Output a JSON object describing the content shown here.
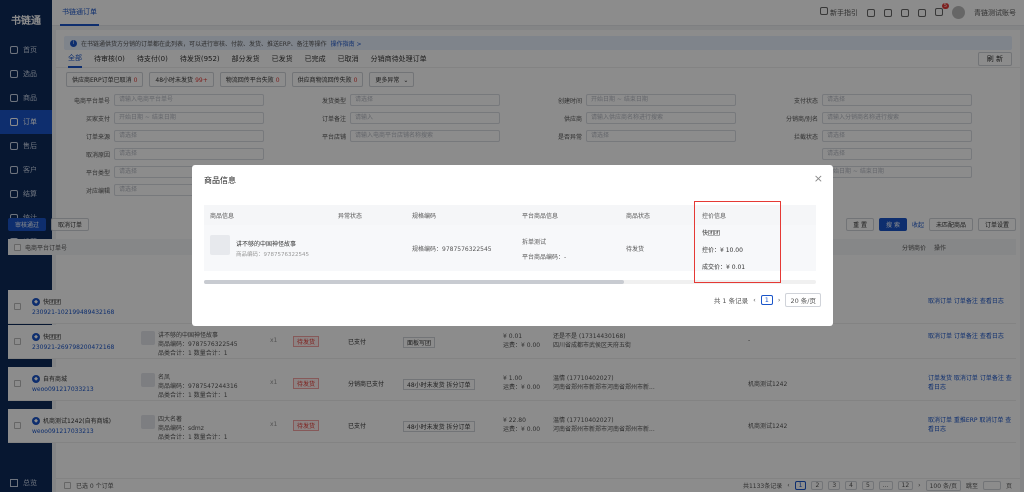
{
  "sidebar": {
    "logo": "书链通",
    "items": [
      {
        "label": "首页",
        "icon": "home-icon"
      },
      {
        "label": "选品",
        "icon": "select-icon"
      },
      {
        "label": "商品",
        "icon": "goods-icon"
      },
      {
        "label": "订单",
        "icon": "order-icon",
        "active": true
      },
      {
        "label": "售后",
        "icon": "aftersale-icon"
      },
      {
        "label": "客户",
        "icon": "customer-icon"
      },
      {
        "label": "结算",
        "icon": "settle-icon"
      },
      {
        "label": "统计",
        "icon": "stats-icon"
      },
      {
        "label": "设置",
        "icon": "settings-icon"
      }
    ],
    "footer": "总览"
  },
  "topbar": {
    "tab": "书链通订单",
    "guide": "新手指引",
    "notify_count": "5",
    "account": "青链测试账号"
  },
  "notice": {
    "text": "在书链通供货方分销的订单都在此列表，可以进行审核、付款、发货、推送ERP、备注等操作",
    "link": "操作指南 >"
  },
  "status_tabs": [
    "全部",
    "待审核(0)",
    "待支付(0)",
    "待发货(952)",
    "部分发货",
    "已发货",
    "已完成",
    "已取消",
    "分销商待处理订单"
  ],
  "refresh_label": "刷 新",
  "chips": [
    {
      "label": "供应商ERP订单已取消",
      "num": "0"
    },
    {
      "label": "48小时未发货",
      "num": "99+"
    },
    {
      "label": "物流回传平台失败",
      "num": "0"
    },
    {
      "label": "供应商物流回传失败",
      "num": "0"
    },
    {
      "label": "更多异常",
      "num": ""
    }
  ],
  "filters": [
    [
      {
        "label": "电商平台单号",
        "ph": "请输入电商平台单号"
      },
      {
        "label": "发货类型",
        "ph": "请选择"
      },
      {
        "label": "创建时间",
        "ph": "开始日期 ~ 结束日期"
      },
      {
        "label": "支付状态",
        "ph": "请选择"
      }
    ],
    [
      {
        "label": "买家支付",
        "ph": "开始日期 ~ 结束日期"
      },
      {
        "label": "订单备注",
        "ph": "请输入"
      },
      {
        "label": "供应商",
        "ph": "请输入供应商名称进行搜索"
      },
      {
        "label": "分销商/别名",
        "ph": "请输入分销商名称进行搜索"
      }
    ],
    [
      {
        "label": "订单来源",
        "ph": "请选择"
      },
      {
        "label": "平台店铺",
        "ph": "请输入电商平台店铺名称搜索"
      },
      {
        "label": "是否异常",
        "ph": "请选择"
      },
      {
        "label": "拦截状态",
        "ph": "请选择"
      }
    ],
    [
      {
        "label": "取消原因",
        "ph": "请选择"
      },
      {
        "label": "",
        "ph": ""
      },
      {
        "label": "",
        "ph": ""
      },
      {
        "label": "",
        "ph": "请选择"
      }
    ],
    [
      {
        "label": "平台类型",
        "ph": "请选择"
      },
      {
        "label": "",
        "ph": ""
      },
      {
        "label": "",
        "ph": ""
      },
      {
        "label": "",
        "ph": "开始日期 ~ 结束日期"
      }
    ],
    [
      {
        "label": "对应编辑",
        "ph": "请选择"
      },
      {
        "label": "",
        "ph": ""
      },
      {
        "label": "",
        "ph": ""
      },
      {
        "label": "",
        "ph": ""
      }
    ]
  ],
  "toolbar": {
    "audit": "审核通过",
    "cancel": "取消订单",
    "reset": "重 置",
    "search": "搜 索",
    "collapse": "收起",
    "unmatched": "未匹配商品",
    "settings": "订单设置"
  },
  "table": {
    "col_order": "电商平台订单号",
    "col_op": "操作",
    "col_price": "分销商价"
  },
  "rows": [
    {
      "shop": "快团团",
      "no": "230921-102199489432168",
      "goods": "",
      "op": "取消订单 订单备注 查看日志",
      "amount": "",
      "addr": "",
      "status": "",
      "ship": "",
      "price": "-"
    },
    {
      "shop": "快团团",
      "no": "230921-269798200472168",
      "goods": "讲不够的中国神怪故事\n商品编码：9787576322545\n品类合计：1  数量合计：1",
      "op": "取消订单 订单备注 查看日志",
      "amount": "¥ 0.01\n运费：¥ 0.00",
      "addr": "还是不是 (17314430168)\n四川省成都市武侯区天府五街",
      "status": "已支付",
      "ship": "面板写团",
      "price": "-",
      "tag": "待发货",
      "qty": "x1"
    },
    {
      "shop": "自有商城",
      "no": "weoo091217033213",
      "goods": "名凤\n商品编码：9787547244316\n品类合计：1  数量合计：1",
      "op": "订单发货 取消订单 订单备注 查看日志",
      "amount": "¥ 1.00\n运费：¥ 0.00",
      "addr": "温情 (17710402027)\n河南省郑州市新郑市河南省郑州市新...",
      "status": "分销商已支付",
      "ship": "48小时未发货 拆分订单",
      "price": "机商测试1242",
      "tag": "待发货",
      "qty": "x1"
    },
    {
      "shop": "机商测试1242(自有商城)",
      "no": "weoo091217033213",
      "goods": "四大名著\n商品编码：sdmz\n品类合计：1  数量合计：1",
      "op": "取消订单 重推ERP 取消订单 查看日志",
      "amount": "¥ 22.80\n运费：¥ 0.00",
      "addr": "温情 (17710402027)\n河南省郑州市新郑市河南省郑州市新...",
      "status": "已支付",
      "ship": "48小时未发货 拆分订单",
      "price": "机商测试1242",
      "tag": "待发货",
      "qty": "x1"
    }
  ],
  "pager": {
    "selected": "已选  0 个订单",
    "total": "共1133条记录",
    "pages": [
      "1",
      "2",
      "3",
      "4",
      "5",
      "...",
      "12"
    ],
    "size": "100 条/页",
    "jump": "跳至",
    "page_unit": "页"
  },
  "modal": {
    "title": "商品信息",
    "headers": [
      "商品信息",
      "异常状态",
      "规格编码",
      "平台商品信息",
      "商品状态",
      "控价信息"
    ],
    "goods_name": "讲不够的中国神怪故事",
    "goods_code": "商品编码：9787576322545",
    "spec_code": "规格编码：9787576322545",
    "platform_name": "拆单测试",
    "platform_code": "平台商品编码：-",
    "goods_status": "待发货",
    "price_shop": "快团团",
    "price_control": "控价：¥ 10.00",
    "price_deal": "成交价：¥ 0.01",
    "total": "共 1 条记录",
    "page": "1",
    "size": "20 条/页"
  },
  "colors": {
    "primary": "#1a55c9",
    "sidebar": "#0e2a5a",
    "danger": "#e53935"
  }
}
